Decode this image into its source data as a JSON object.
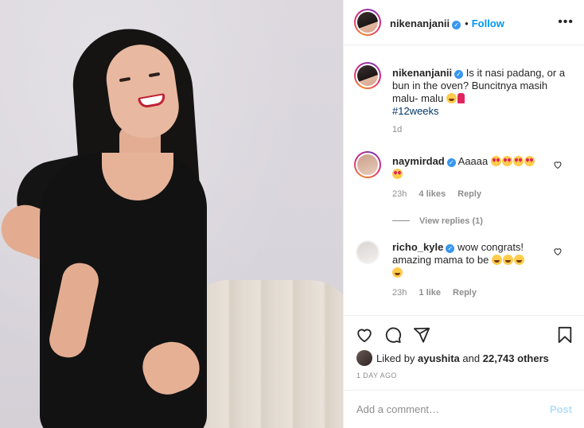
{
  "post": {
    "author": "nikenanjanii",
    "follow_label": "Follow",
    "separator": "•",
    "more_label": "•••"
  },
  "caption": {
    "username": "nikenanjanii",
    "line1": "Is it nasi padang, or a",
    "line2": "bun in the oven? Buncitnya masih",
    "line3": "malu- malu",
    "hashtag": "#12weeks",
    "time": "1d"
  },
  "comments": [
    {
      "username": "naymirdad",
      "text": "Aaaaa",
      "time": "23h",
      "likes": "4 likes",
      "reply_label": "Reply",
      "view_replies": "View replies (1)"
    },
    {
      "username": "richo_kyle",
      "line1": "wow congrats!",
      "line2": "amazing mama to be",
      "time": "23h",
      "likes": "1 like",
      "reply_label": "Reply"
    }
  ],
  "likes": {
    "prefix": "Liked by",
    "user": "ayushita",
    "conjunction": "and",
    "others": "22,743 others"
  },
  "time_ago": "1 DAY AGO",
  "comment_box": {
    "placeholder": "Add a comment…",
    "post_label": "Post"
  },
  "icons": {
    "like": "heart-icon",
    "comment": "comment-bubble-icon",
    "share": "send-icon",
    "save": "bookmark-icon",
    "more": "more-options-icon",
    "verified": "verified-badge-icon"
  },
  "colors": {
    "accent": "#0095f6",
    "hashtag": "#00376b",
    "muted": "#8e8e8e",
    "verified": "#3897f0",
    "post_disabled": "#b2dffc"
  }
}
